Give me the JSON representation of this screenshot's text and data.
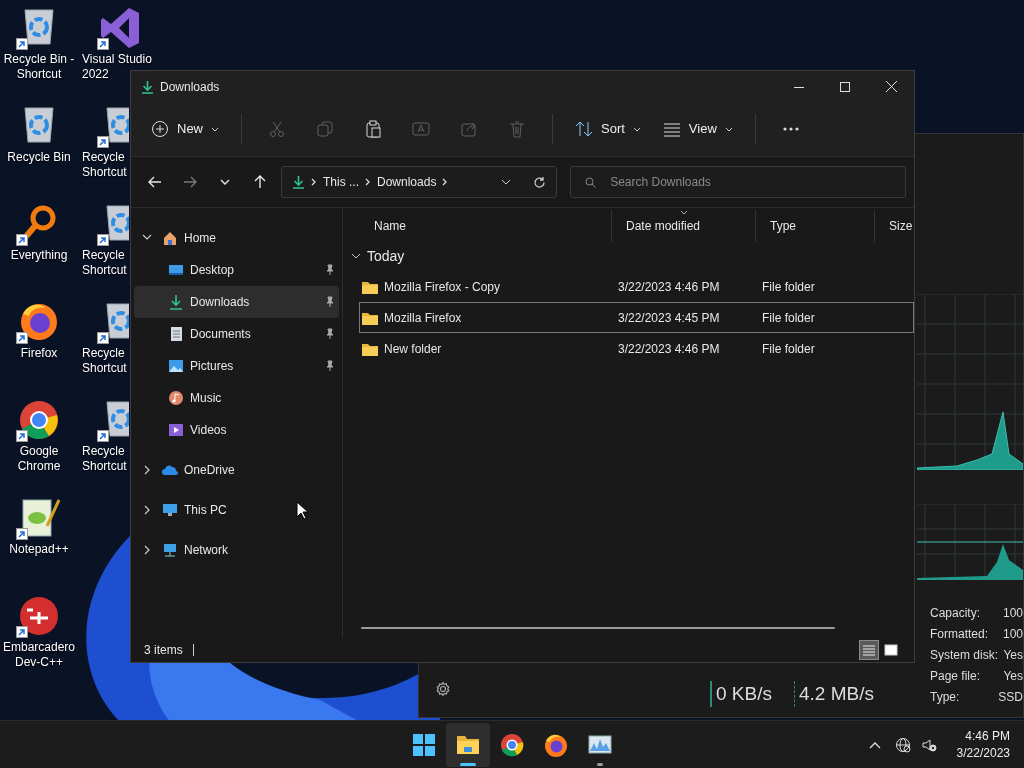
{
  "desktop_column_1": [
    {
      "kind": "recycle",
      "shortcut": true,
      "lines": [
        "Recycle Bin -",
        "Shortcut"
      ]
    },
    {
      "kind": "recycle",
      "shortcut": false,
      "lines": [
        "Recycle Bin"
      ]
    },
    {
      "kind": "everything",
      "shortcut": true,
      "lines": [
        "Everything"
      ]
    },
    {
      "kind": "firefox",
      "shortcut": true,
      "lines": [
        "Firefox"
      ]
    },
    {
      "kind": "chrome",
      "shortcut": true,
      "lines": [
        "Google",
        "Chrome"
      ]
    },
    {
      "kind": "notepad",
      "shortcut": true,
      "lines": [
        "Notepad++"
      ]
    },
    {
      "kind": "devcpp",
      "shortcut": true,
      "lines": [
        "Embarcadero",
        "Dev-C++"
      ]
    }
  ],
  "desktop_column_2": [
    {
      "kind": "vs",
      "shortcut": true,
      "lines": [
        "Visual Studio",
        "2022"
      ]
    },
    {
      "kind": "recycle",
      "shortcut": true,
      "lines": [
        "Recycle",
        "Shortcut"
      ]
    },
    {
      "kind": "recycle",
      "shortcut": true,
      "lines": [
        "Recycle",
        "Shortcut"
      ]
    },
    {
      "kind": "recycle",
      "shortcut": true,
      "lines": [
        "Recycle",
        "Shortcut"
      ]
    },
    {
      "kind": "recycle",
      "shortcut": true,
      "lines": [
        "Recycle",
        "Shortcut"
      ]
    }
  ],
  "task_manager": {
    "properties": [
      {
        "label": "Capacity:",
        "value": "100"
      },
      {
        "label": "Formatted:",
        "value": "100"
      },
      {
        "label": "System disk:",
        "value": "Yes"
      },
      {
        "label": "Page file:",
        "value": "Yes"
      },
      {
        "label": "Type:",
        "value": "SSD"
      }
    ],
    "read_speed": "0 KB/s",
    "write_speed": "4.2 MB/s"
  },
  "explorer": {
    "window": {
      "title": "Downloads"
    },
    "toolbar": [
      {
        "kind": "new",
        "label": "New",
        "disabled": false
      },
      {
        "kind": "separator"
      },
      {
        "kind": "cut",
        "disabled": true
      },
      {
        "kind": "copy",
        "disabled": true
      },
      {
        "kind": "paste",
        "disabled": false
      },
      {
        "kind": "rename",
        "disabled": true
      },
      {
        "kind": "share",
        "disabled": true
      },
      {
        "kind": "delete",
        "disabled": true
      },
      {
        "kind": "separator"
      },
      {
        "kind": "sort",
        "label": "Sort",
        "disabled": false
      },
      {
        "kind": "view",
        "label": "View",
        "disabled": false
      },
      {
        "kind": "separator"
      },
      {
        "kind": "more",
        "disabled": false
      }
    ],
    "nav": [
      {
        "kind": "back",
        "disabled": false
      },
      {
        "kind": "forward",
        "disabled": true
      },
      {
        "kind": "recent",
        "disabled": false
      },
      {
        "kind": "up",
        "disabled": false
      }
    ],
    "breadcrumbs": [
      "This ...",
      "Downloads"
    ],
    "search": {
      "placeholder": "Search Downloads"
    },
    "sidebar": [
      {
        "kind": "home",
        "label": "Home",
        "expanded": true,
        "children": [
          {
            "kind": "desktop",
            "label": "Desktop",
            "pinned": true,
            "selected": false
          },
          {
            "kind": "downloads",
            "label": "Downloads",
            "pinned": true,
            "selected": true
          },
          {
            "kind": "documents",
            "label": "Documents",
            "pinned": true,
            "selected": false
          },
          {
            "kind": "pictures",
            "label": "Pictures",
            "pinned": true,
            "selected": false
          },
          {
            "kind": "music",
            "label": "Music",
            "pinned": false,
            "selected": false
          },
          {
            "kind": "videos",
            "label": "Videos",
            "pinned": false,
            "selected": false
          }
        ]
      },
      {
        "kind": "onedrive",
        "label": "OneDrive",
        "expanded": false
      },
      {
        "kind": "pc",
        "label": "This PC",
        "expanded": false
      },
      {
        "kind": "network",
        "label": "Network",
        "expanded": false
      }
    ],
    "columns": [
      {
        "label": "Name",
        "sorted": false
      },
      {
        "label": "Date modified",
        "sorted": true
      },
      {
        "label": "Type",
        "sorted": false
      },
      {
        "label": "Size",
        "sorted": false
      }
    ],
    "group": {
      "label": "Today",
      "expanded": true
    },
    "rows": [
      {
        "name": "Mozilla Firefox - Copy",
        "date": "3/22/2023 4:46 PM",
        "type": "File folder",
        "selected": false
      },
      {
        "name": "Mozilla Firefox",
        "date": "3/22/2023 4:45 PM",
        "type": "File folder",
        "selected": true
      },
      {
        "name": "New folder",
        "date": "3/22/2023 4:46 PM",
        "type": "File folder",
        "selected": false
      }
    ],
    "status": "3 items",
    "view_modes": [
      {
        "kind": "details",
        "selected": true
      },
      {
        "kind": "tiles",
        "selected": false
      }
    ]
  },
  "taskbar": {
    "apps": [
      {
        "kind": "start",
        "active": false,
        "running": false
      },
      {
        "kind": "explorer",
        "active": true,
        "running": true
      },
      {
        "kind": "chrome",
        "active": false,
        "running": false
      },
      {
        "kind": "firefox",
        "active": false,
        "running": false
      },
      {
        "kind": "taskmgr",
        "active": false,
        "running": true
      }
    ],
    "time": "4:46 PM",
    "date": "3/22/2023"
  }
}
